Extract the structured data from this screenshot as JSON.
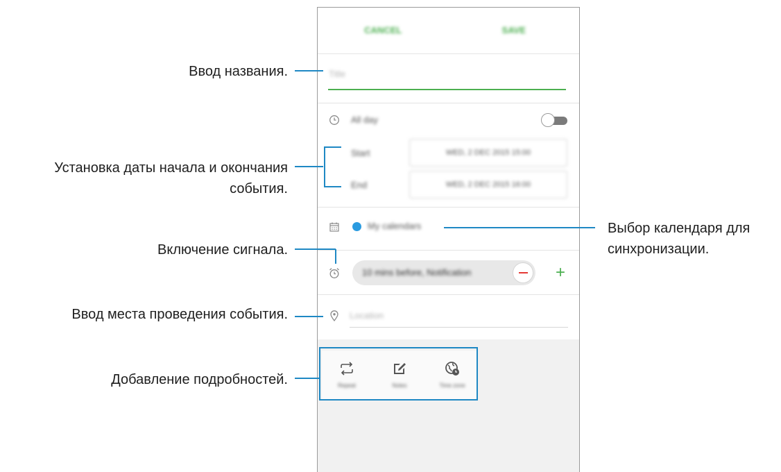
{
  "annotations": {
    "title_input": "Ввод названия.",
    "dates_line1": "Установка даты начала и окончания",
    "dates_line2": "события.",
    "alarm": "Включение сигнала.",
    "location": "Ввод места проведения события.",
    "details": "Добавление подробностей.",
    "calendar_line1": "Выбор календаря для",
    "calendar_line2": "синхронизации."
  },
  "header": {
    "cancel_label": "CANCEL",
    "save_label": "SAVE"
  },
  "form": {
    "title_placeholder": "Title",
    "all_day_label": "All day",
    "start_label": "Start",
    "start_value": "WED, 2 DEC 2015 15:00",
    "end_label": "End",
    "end_value": "WED, 2 DEC 2015 16:00",
    "calendar_name": "My calendars",
    "calendar_color": "#2a9be0",
    "reminder_value": "10 mins before, Notification",
    "location_placeholder": "Location"
  },
  "detail_tiles": [
    {
      "label": "Repeat",
      "icon": "repeat-icon"
    },
    {
      "label": "Notes",
      "icon": "notes-icon"
    },
    {
      "label": "Time zone",
      "icon": "time-zone-icon"
    }
  ],
  "colors": {
    "accent": "#4caf50",
    "highlight_border": "#1e88c4",
    "remove": "#e53935"
  }
}
